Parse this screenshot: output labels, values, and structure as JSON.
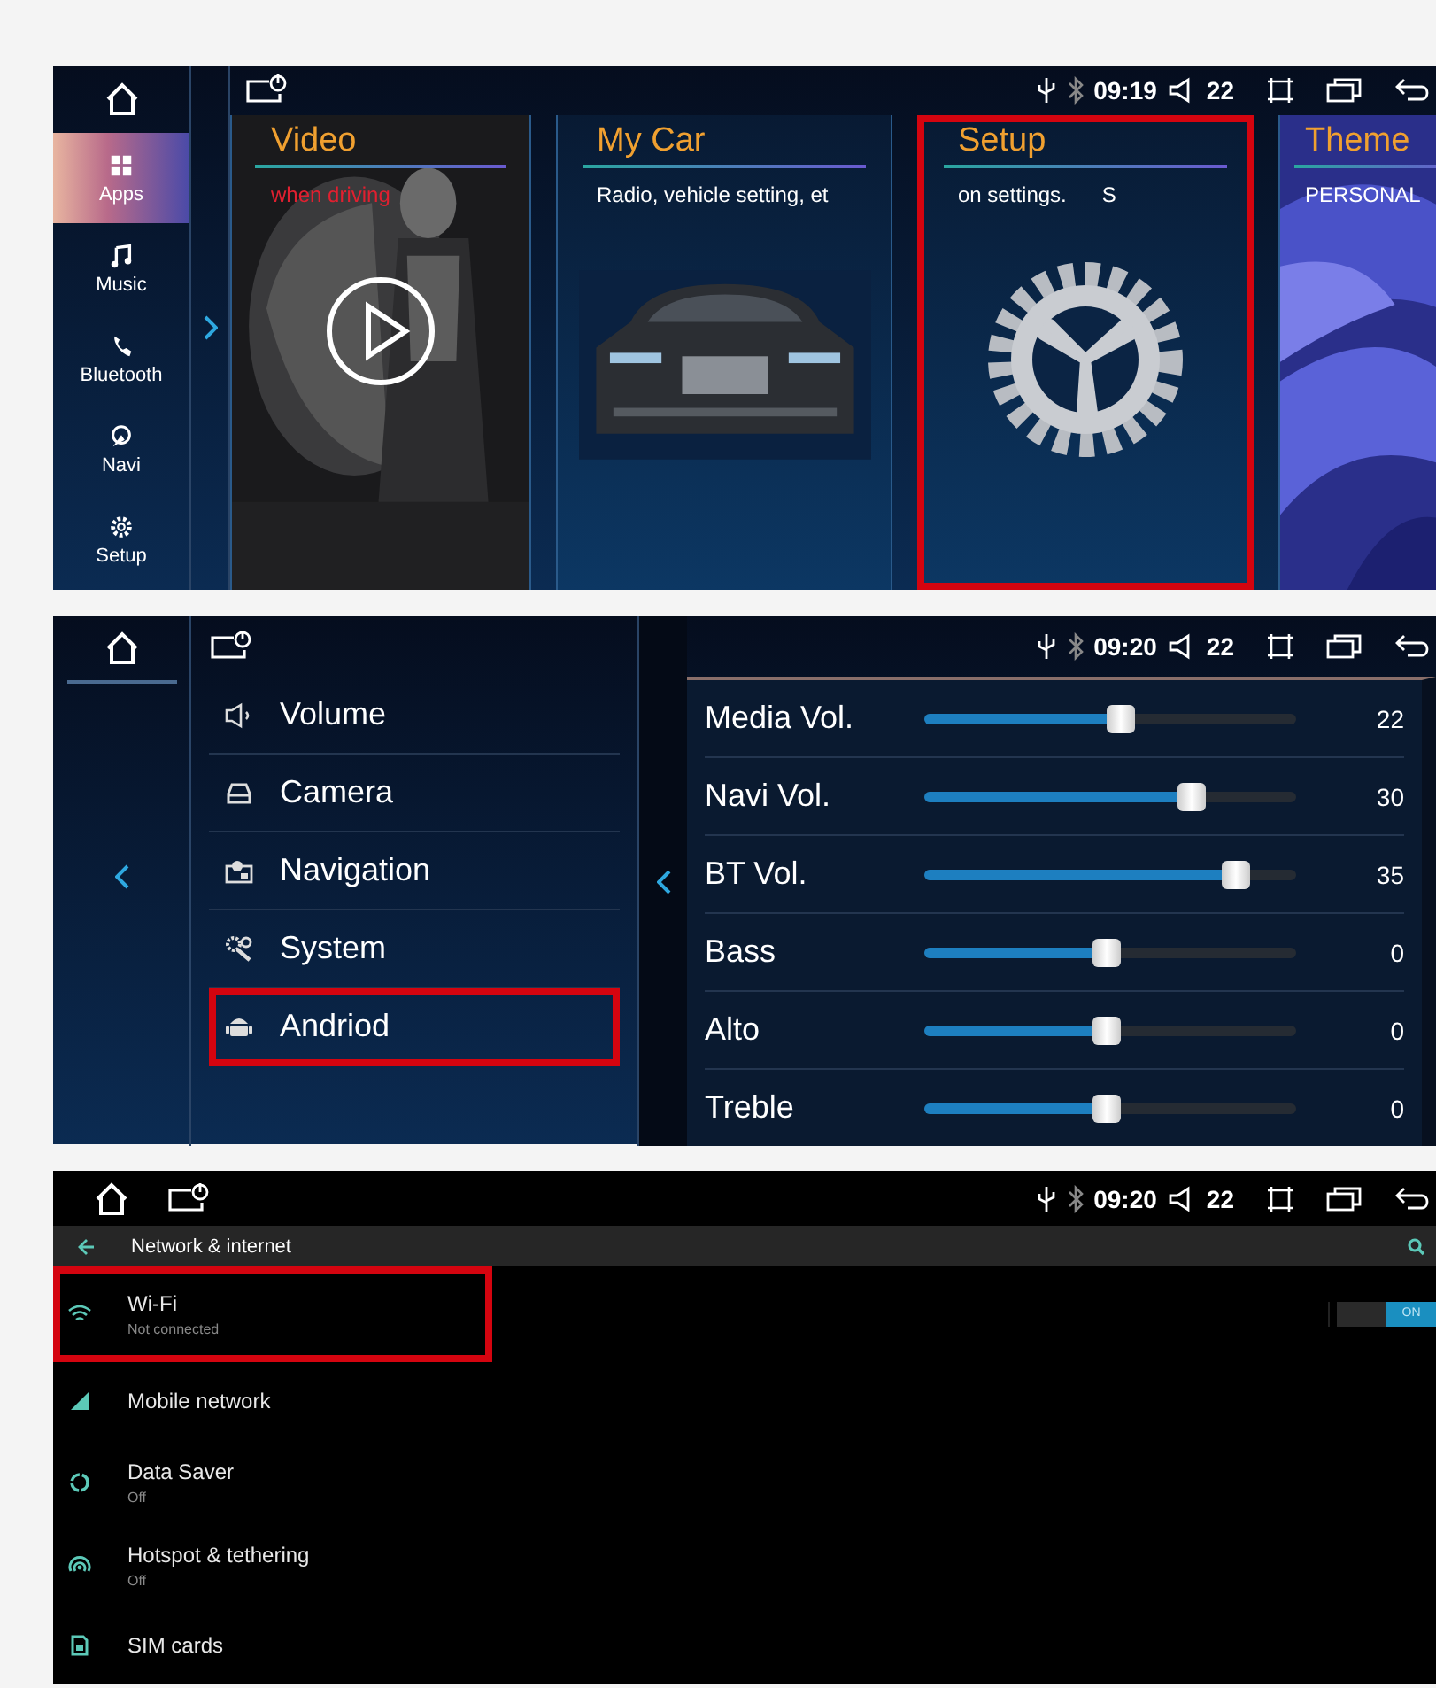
{
  "home_screen": {
    "status": {
      "time": "09:19",
      "volume": "22"
    },
    "sidebar": [
      {
        "kind": "apps",
        "label": "Apps",
        "selected": true
      },
      {
        "kind": "music",
        "label": "Music",
        "selected": false
      },
      {
        "kind": "phone",
        "label": "Bluetooth",
        "selected": false
      },
      {
        "kind": "navi",
        "label": "Navi",
        "selected": false
      },
      {
        "kind": "setup",
        "label": "Setup",
        "selected": false
      }
    ],
    "cards": [
      {
        "kind": "video",
        "title": "Video",
        "subtitle": "when driving",
        "highlighted": false
      },
      {
        "kind": "car",
        "title": "My Car",
        "subtitle": "Radio, vehicle setting, et",
        "highlighted": false
      },
      {
        "kind": "setup",
        "title": "Setup",
        "subtitle": "on settings.      S",
        "highlighted": true
      },
      {
        "kind": "theme",
        "title": "Theme",
        "subtitle": "PERSONAL",
        "highlighted": false
      }
    ]
  },
  "settings_screen": {
    "status": {
      "time": "09:20",
      "volume": "22"
    },
    "menu": [
      {
        "kind": "volume",
        "label": "Volume",
        "highlighted": false
      },
      {
        "kind": "camera",
        "label": "Camera",
        "highlighted": false
      },
      {
        "kind": "navigation",
        "label": "Navigation",
        "highlighted": false
      },
      {
        "kind": "system",
        "label": "System",
        "highlighted": false
      },
      {
        "kind": "android",
        "label": "Andriod",
        "highlighted": true
      }
    ],
    "sliders": [
      {
        "label": "Media Vol.",
        "level": 0.53,
        "reading": "22"
      },
      {
        "label": "Navi Vol.",
        "level": 0.72,
        "reading": "30"
      },
      {
        "label": "BT Vol.",
        "level": 0.84,
        "reading": "35"
      },
      {
        "label": "Bass",
        "level": 0.49,
        "reading": "0"
      },
      {
        "label": "Alto",
        "level": 0.49,
        "reading": "0"
      },
      {
        "label": "Treble",
        "level": 0.49,
        "reading": "0"
      }
    ]
  },
  "network_screen": {
    "status": {
      "time": "09:20",
      "volume": "22"
    },
    "title": "Network & internet",
    "items": [
      {
        "kind": "wifi",
        "title": "Wi-Fi",
        "subtitle": "Not connected",
        "highlighted": true,
        "toggle": {
          "on": true,
          "label": "ON"
        }
      },
      {
        "kind": "mobile",
        "title": "Mobile network",
        "highlighted": false
      },
      {
        "kind": "datasaver",
        "title": "Data Saver",
        "subtitle": "Off",
        "highlighted": false
      },
      {
        "kind": "hotspot",
        "title": "Hotspot & tethering",
        "subtitle": "Off",
        "highlighted": false
      },
      {
        "kind": "sim",
        "title": "SIM cards",
        "highlighted": false
      }
    ]
  }
}
